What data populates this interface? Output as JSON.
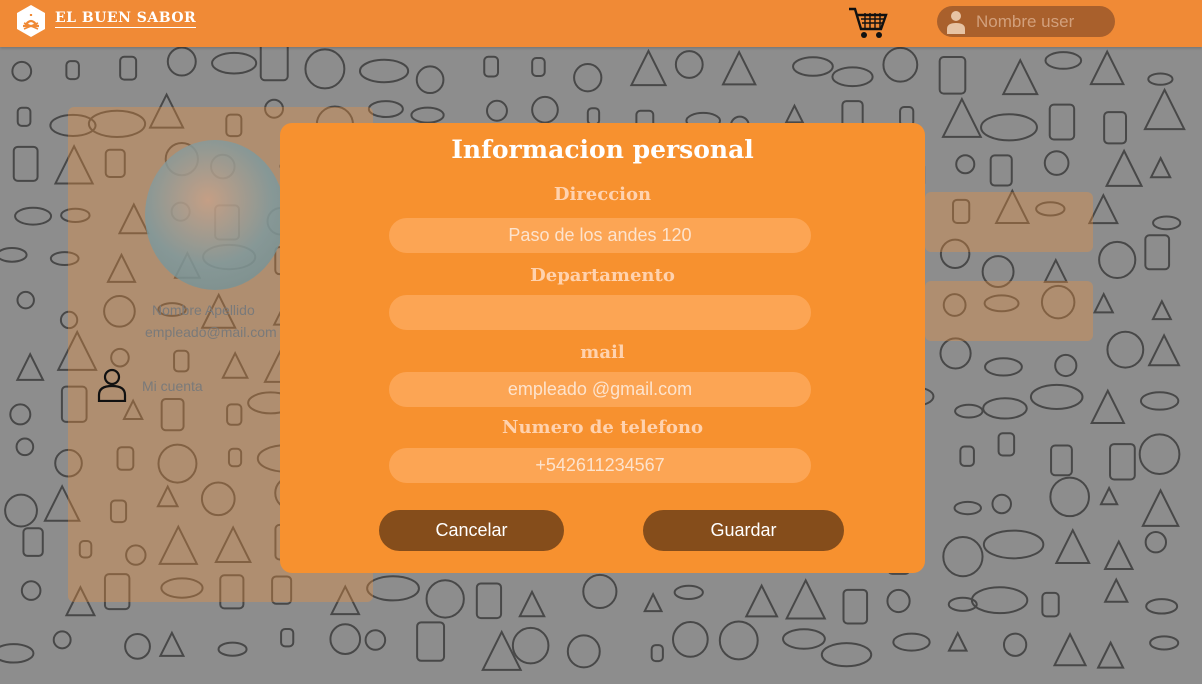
{
  "header": {
    "brand": "EL BUEN SABOR",
    "user_name": "Nombre user",
    "accent": "#f08a36"
  },
  "sidebar": {
    "name": "Nombre Apellido",
    "email": "empleado@mail.com",
    "account_label": "Mi cuenta"
  },
  "modal": {
    "title": "Informacion personal",
    "fields": [
      {
        "label": "Direccion",
        "value": "Paso de los andes 120"
      },
      {
        "label": "Departamento",
        "value": ""
      },
      {
        "label": "mail",
        "value": "empleado @gmail.com"
      },
      {
        "label": "Numero de telefono",
        "value": "+542611234567"
      }
    ],
    "cancel_label": "Cancelar",
    "save_label": "Guardar",
    "bg_color": "#f7912f",
    "button_color": "#854d1b"
  }
}
